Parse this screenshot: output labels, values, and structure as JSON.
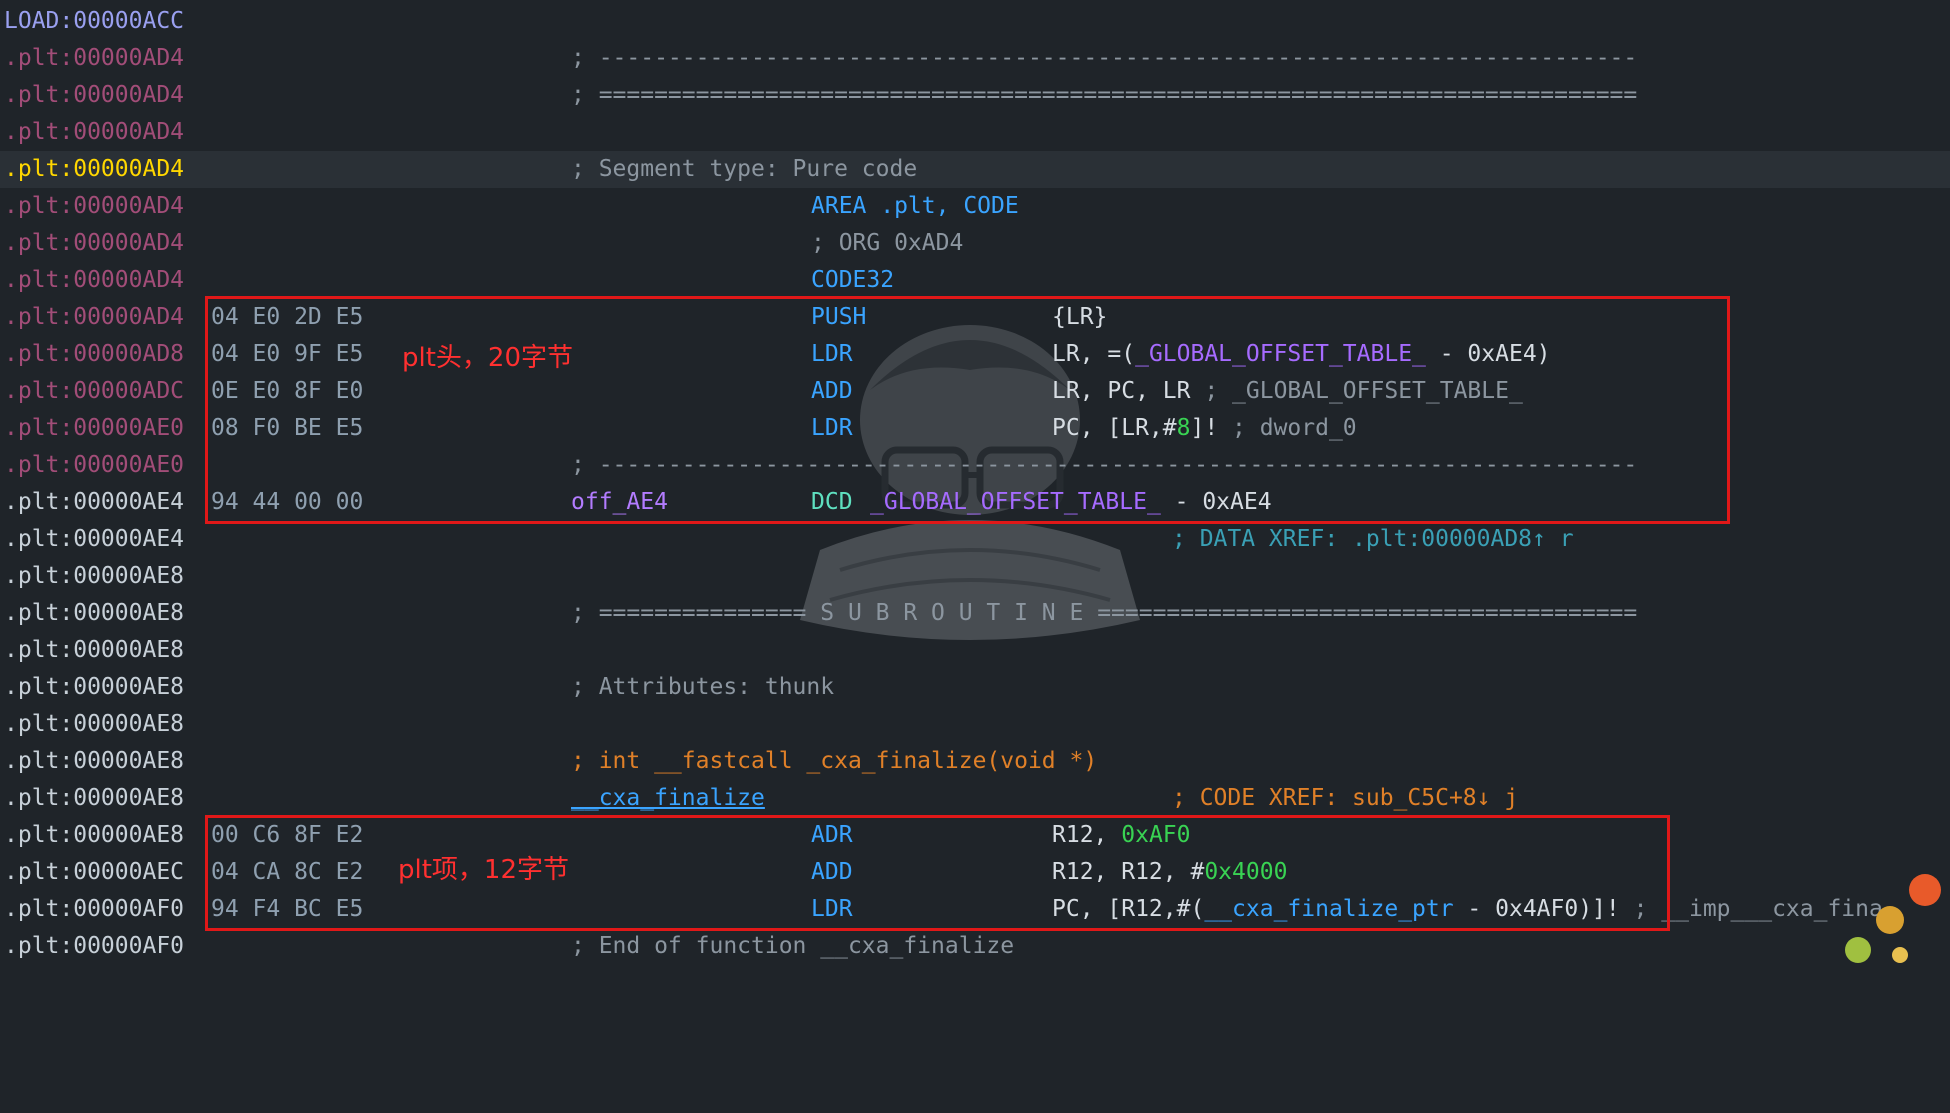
{
  "lines": [
    {
      "addr": "LOAD:00000ACC",
      "text": ""
    },
    {
      "addr": ".plt:00000AD4",
      "text": "; ---------------------------------------------------------------------------"
    },
    {
      "addr": ".plt:00000AD4",
      "text": "; ==========================================================================="
    },
    {
      "addr": ".plt:00000AD4",
      "text": ""
    },
    {
      "addr": ".plt:00000AD4",
      "text": "; Segment type: Pure code"
    },
    {
      "addr": ".plt:00000AD4",
      "directive": "AREA .plt, CODE"
    },
    {
      "addr": ".plt:00000AD4",
      "directive": "; ORG 0xAD4"
    },
    {
      "addr": ".plt:00000AD4",
      "directive": "CODE32"
    },
    {
      "addr": ".plt:00000AD4",
      "bytes": "04 E0 2D E5",
      "mnem": "PUSH",
      "ops": "{LR}"
    },
    {
      "addr": ".plt:00000AD8",
      "bytes": "04 E0 9F E5",
      "mnem": "LDR",
      "ops_pre": "LR, =(",
      "ops_sym": "_GLOBAL_OFFSET_TABLE_",
      "ops_post": " - 0xAE4)"
    },
    {
      "addr": ".plt:00000ADC",
      "bytes": "0E E0 8F E0",
      "mnem": "ADD",
      "ops": "LR, PC, LR",
      "comment": " ; _GLOBAL_OFFSET_TABLE_"
    },
    {
      "addr": ".plt:00000AE0",
      "bytes": "08 F0 BE E5",
      "mnem": "LDR",
      "ops_pre": "PC, [LR,#",
      "ops_num": "8",
      "ops_post": "]!",
      "comment": " ; dword_0"
    },
    {
      "addr": ".plt:00000AE0",
      "text": "; ---------------------------------------------------------------------------"
    },
    {
      "addr": ".plt:00000AE4",
      "bytes": "94 44 00 00",
      "label": "off_AE4",
      "mnem": "DCD",
      "ops_sym": "_GLOBAL_OFFSET_TABLE_",
      "ops_post": " - 0xAE4"
    },
    {
      "addr": ".plt:00000AE4",
      "xref": "; DATA XREF: .plt:00000AD8↑ r"
    },
    {
      "addr": ".plt:00000AE8",
      "text": ""
    },
    {
      "addr": ".plt:00000AE8",
      "text": "; =============== S U B R O U T I N E ======================================="
    },
    {
      "addr": ".plt:00000AE8",
      "text": ""
    },
    {
      "addr": ".plt:00000AE8",
      "text": "; Attributes: thunk"
    },
    {
      "addr": ".plt:00000AE8",
      "text": ""
    },
    {
      "addr": ".plt:00000AE8",
      "text": "; int __fastcall _cxa_finalize(void *)"
    },
    {
      "addr": ".plt:00000AE8",
      "label": "__cxa_finalize",
      "xref": "; CODE XREF: sub_C5C+8↓ j"
    },
    {
      "addr": ".plt:00000AE8",
      "bytes": "00 C6 8F E2",
      "mnem": "ADR",
      "ops_pre": "R12, ",
      "ops_num": "0xAF0"
    },
    {
      "addr": ".plt:00000AEC",
      "bytes": "04 CA 8C E2",
      "mnem": "ADD",
      "ops_pre": "R12, R12, #",
      "ops_num": "0x4000"
    },
    {
      "addr": ".plt:00000AF0",
      "bytes": "94 F4 BC E5",
      "mnem": "LDR",
      "ops_pre": "PC, [R12,#(",
      "ops_sym": "__cxa_finalize_ptr",
      "ops_post": " - 0x4AF0)]!",
      "comment": " ; __imp___cxa_fina"
    },
    {
      "addr": ".plt:00000AF0",
      "text": "; End of function __cxa_finalize"
    }
  ],
  "annotations": {
    "plt_head": "plt头，20字节",
    "plt_entry": "plt项，12字节"
  },
  "colors": {
    "background": "#1f2429",
    "highlight_row": "#2a3036",
    "red_box": "#e01818",
    "cursor_address": "#ffd700"
  }
}
